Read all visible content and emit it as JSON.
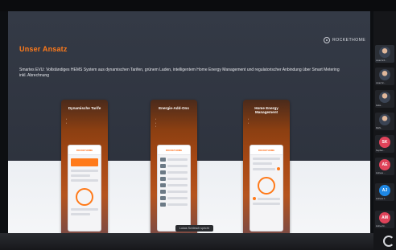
{
  "slide": {
    "title": "Unser Ansatz",
    "logo_text": "ROCKETHOME",
    "intro": "Smartes EVU: Vollständiges HEMS System aus dynamischen Tarifen, grünem Laden, intelligentem Home Energy Management und regulatorischer Anbindung über Smart Metering inkl. Abrechnung",
    "cards": [
      {
        "title": "Dynamische Tarife",
        "bullets": [
          "",
          ""
        ]
      },
      {
        "title": "Energie-Add-Ons",
        "bullets": [
          "",
          "",
          ""
        ]
      },
      {
        "title": "Home Energy Management",
        "bullets": [
          "",
          ""
        ]
      }
    ],
    "app_header": "ROCKETHOME"
  },
  "caption": "Lukas Schlesch spricht",
  "participants": [
    {
      "initials": "",
      "label": "Lukas Sch...",
      "color": "#3b4454",
      "photo": true
    },
    {
      "initials": "",
      "label": "Lukas Sc...",
      "color": "#3b4454",
      "photo": true
    },
    {
      "initials": "",
      "label": "Fabia...",
      "color": "#3b4454",
      "photo": true
    },
    {
      "initials": "",
      "label": "Mathi...",
      "color": "#3b4454",
      "photo": true
    },
    {
      "initials": "SK",
      "label": "Stephan...",
      "color": "#e0435a",
      "photo": false
    },
    {
      "initials": "AE",
      "label": "Andreas ...",
      "color": "#e0435a",
      "photo": false
    },
    {
      "initials": "AJ",
      "label": "Andreas J...",
      "color": "#1e88e5",
      "photo": false
    },
    {
      "initials": "AM",
      "label": "Andrea M...",
      "color": "#e0435a",
      "photo": false
    }
  ],
  "icons": {
    "logo": "rockethome-logo-icon",
    "sync": "sync-icon",
    "mic": "mic-icon"
  }
}
